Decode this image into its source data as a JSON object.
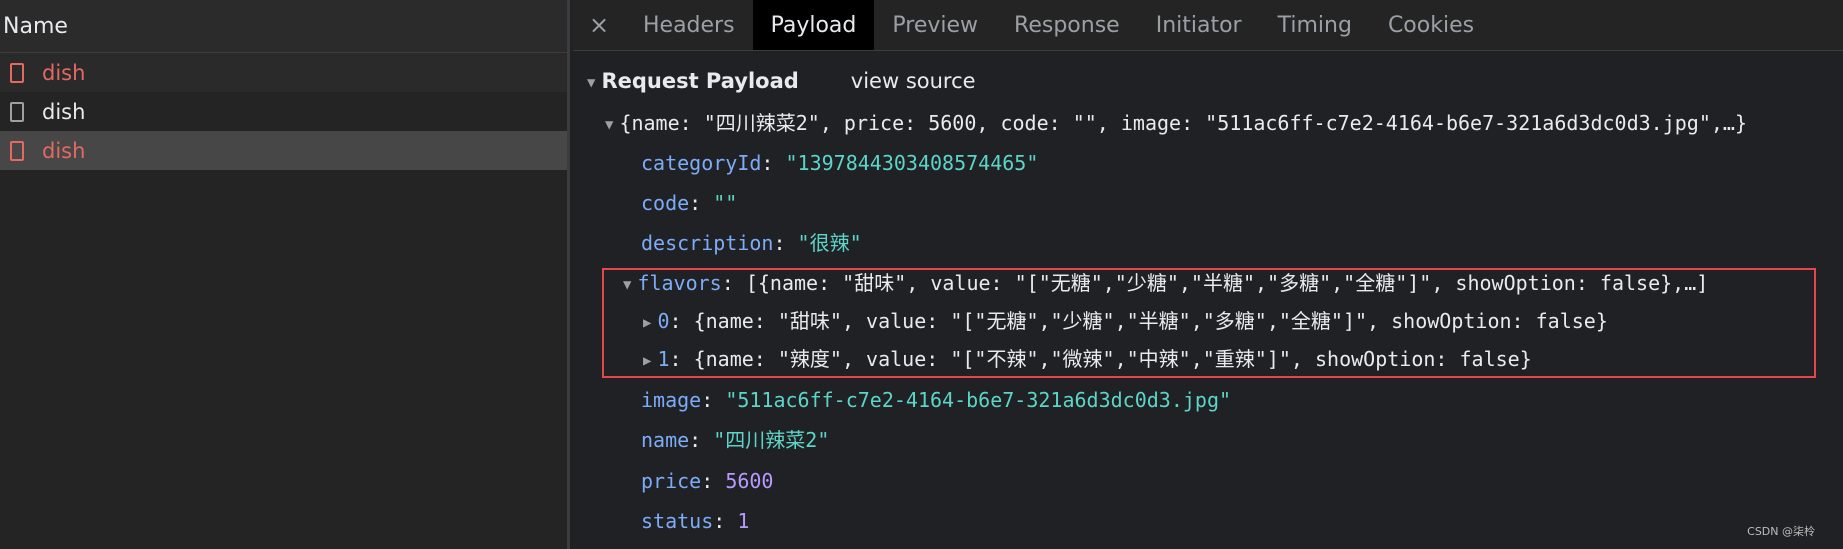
{
  "list": {
    "header": "Name",
    "rows": [
      {
        "name": "dish",
        "status": "error"
      },
      {
        "name": "dish",
        "status": "ok"
      },
      {
        "name": "dish",
        "status": "error",
        "selected": true
      }
    ]
  },
  "tabs": {
    "close": "×",
    "items": [
      "Headers",
      "Payload",
      "Preview",
      "Response",
      "Initiator",
      "Timing",
      "Cookies"
    ],
    "active": "Payload"
  },
  "payload": {
    "section_title": "Request Payload",
    "view_source": "view source",
    "summary": "{name: \"四川辣菜2\", price: 5600, code: \"\", image: \"511ac6ff-c7e2-4164-b6e7-321a6d3dc0d3.jpg\",…}",
    "fields": {
      "categoryId": {
        "key": "categoryId",
        "value": "\"1397844303408574465\""
      },
      "code": {
        "key": "code",
        "value": "\"\""
      },
      "description": {
        "key": "description",
        "value": "\"很辣\""
      },
      "flavors": {
        "key": "flavors",
        "summary": "[{name: \"甜味\", value: \"[\"无糖\",\"少糖\",\"半糖\",\"多糖\",\"全糖\"]\", showOption: false},…]",
        "items": [
          {
            "index": "0",
            "value": "{name: \"甜味\", value: \"[\"无糖\",\"少糖\",\"半糖\",\"多糖\",\"全糖\"]\", showOption: false}"
          },
          {
            "index": "1",
            "value": "{name: \"辣度\", value: \"[\"不辣\",\"微辣\",\"中辣\",\"重辣\"]\", showOption: false}"
          }
        ]
      },
      "image": {
        "key": "image",
        "value": "\"511ac6ff-c7e2-4164-b6e7-321a6d3dc0d3.jpg\""
      },
      "name": {
        "key": "name",
        "value": "\"四川辣菜2\""
      },
      "price": {
        "key": "price",
        "value": "5600"
      },
      "status": {
        "key": "status",
        "value": "1"
      }
    }
  },
  "watermark": "CSDN @柒柃",
  "colors": {
    "error": "#e46962",
    "key": "#7cacf8",
    "string": "#5cd5c8",
    "number": "#b89aff",
    "highlight_border": "#e0484a"
  }
}
